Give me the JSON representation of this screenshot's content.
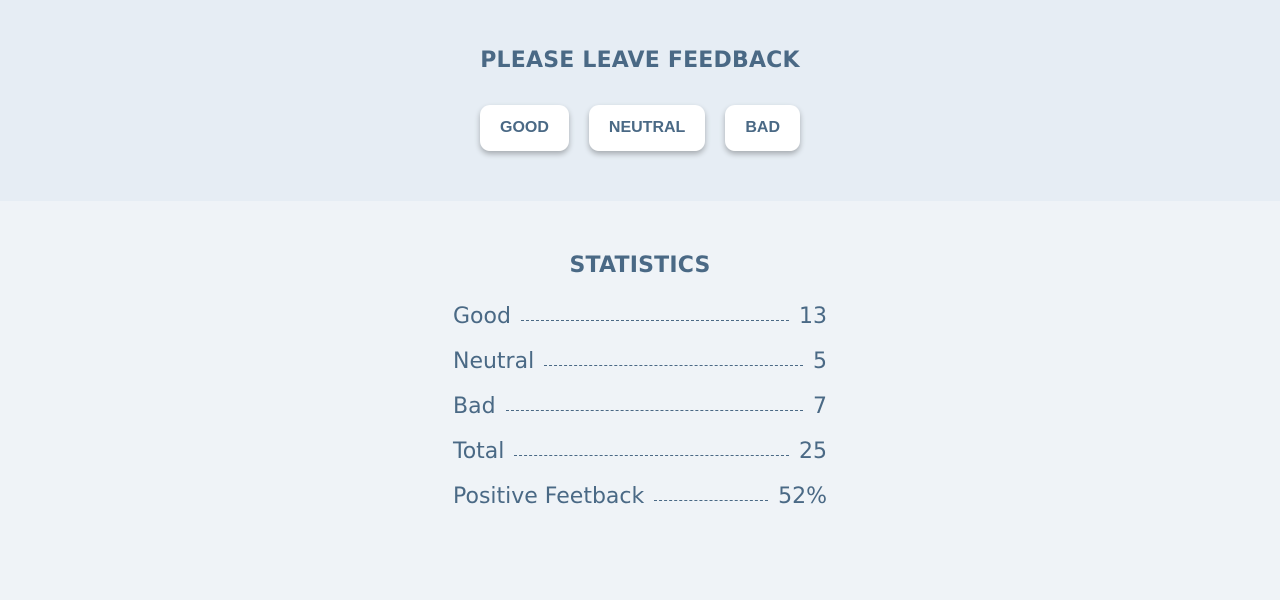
{
  "feedback": {
    "title": "PLEASE LEAVE FEEDBACK",
    "buttons": {
      "good": "GOOD",
      "neutral": "NEUTRAL",
      "bad": "BAD"
    }
  },
  "statistics": {
    "title": "STATISTICS",
    "rows": [
      {
        "label": "Good",
        "value": "13"
      },
      {
        "label": "Neutral",
        "value": "5"
      },
      {
        "label": "Bad",
        "value": "7"
      },
      {
        "label": "Total",
        "value": "25"
      },
      {
        "label": "Positive Feetback",
        "value": "52%"
      }
    ]
  },
  "colors": {
    "text": "#4a6985",
    "feedback_bg": "#e6edf4",
    "stats_bg": "#eff3f7",
    "button_bg": "#ffffff"
  }
}
